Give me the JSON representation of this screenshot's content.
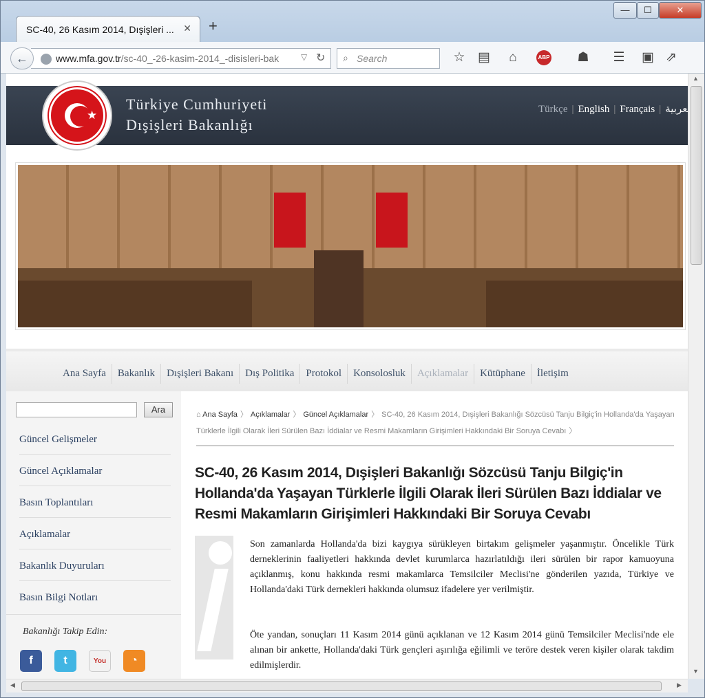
{
  "browser": {
    "tab_title": "SC-40, 26 Kasım 2014, Dışişleri ...",
    "tab_close": "✕",
    "new_tab": "+",
    "url_domain": "www.mfa.gov.tr",
    "url_path": "/sc-40_-26-kasim-2014_-disisleri-bak",
    "search_placeholder": "Search",
    "window_buttons": [
      "—",
      "☐",
      "✕"
    ]
  },
  "header": {
    "org_line1": "Türkiye Cumhuriyeti",
    "org_line2": "Dışişleri Bakanlığı",
    "seal_text": "TÜRKİYE CUMHURİYETİ DIŞİŞLERİ BAKANLIĞI",
    "languages": [
      "Türkçe",
      "English",
      "Français",
      "العربية"
    ]
  },
  "menu": [
    "Ana Sayfa",
    "Bakanlık",
    "Dışişleri Bakanı",
    "Dış Politika",
    "Protokol",
    "Konsolosluk",
    "Açıklamalar",
    "Kütüphane",
    "İletişim"
  ],
  "menu_active": "Açıklamalar",
  "sidebar": {
    "search_button": "Ara",
    "items": [
      "Güncel Gelişmeler",
      "Güncel Açıklamalar",
      "Basın Toplantıları",
      "Açıklamalar",
      "Bakanlık Duyuruları",
      "Basın Bilgi Notları"
    ],
    "follow_label": "Bakanlığı Takip Edin:",
    "social": [
      "facebook",
      "twitter",
      "youtube",
      "rss"
    ]
  },
  "breadcrumb": {
    "home": "Ana Sayfa",
    "level1": "Açıklamalar",
    "level2": "Güncel Açıklamalar",
    "current": "SC-40, 26 Kasım 2014, Dışişleri Bakanlığı Sözcüsü Tanju Bilgiç'in Hollanda'da Yaşayan Türklerle İlgili Olarak İleri Sürülen Bazı İddialar ve Resmi Makamların Girişimleri Hakkındaki Bir Soruya Cevabı"
  },
  "article": {
    "title": "SC-40, 26 Kasım 2014, Dışişleri Bakanlığı Sözcüsü Tanju Bilgiç'in Hollanda'da Yaşayan Türklerle İlgili Olarak İleri Sürülen Bazı İddialar ve Resmi Makamların Girişimleri Hakkındaki Bir Soruya Cevabı",
    "para1": "Son zamanlarda Hollanda'da bizi kaygıya sürükleyen birtakım gelişmeler yaşanmıştır. Öncelikle Türk derneklerinin faaliyetleri hakkında devlet kurumlarca hazırlatıldığı ileri sürülen bir rapor kamuoyuna açıklanmış, konu hakkında resmi makamlarca Temsilciler Meclisi'ne gönderilen yazıda, Türkiye ve Hollanda'daki Türk dernekleri hakkında olumsuz ifadelere yer verilmiştir.",
    "para2": "Öte yandan, sonuçları 11 Kasım 2014 günü açıklanan ve 12 Kasım 2014 günü Temsilciler Meclisi'nde ele alınan bir ankette, Hollanda'daki Türk gençleri aşırılığa eğilimli ve teröre destek veren kişiler olarak takdim edilmişlerdir."
  }
}
